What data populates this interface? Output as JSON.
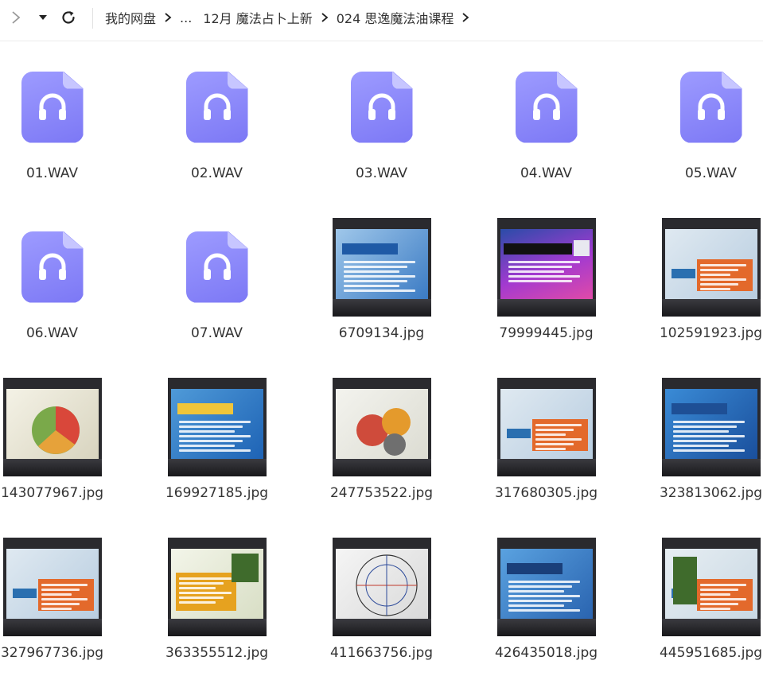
{
  "toolbar": {
    "back_icon": "chevron-right-icon",
    "dropdown_icon": "caret-down-icon",
    "refresh_icon": "refresh-icon"
  },
  "breadcrumb": {
    "items": [
      "我的网盘",
      "...",
      "12月 魔法占卜上新",
      "024 思逸魔法油课程"
    ]
  },
  "files": [
    {
      "name": "01.WAV",
      "type": "audio"
    },
    {
      "name": "02.WAV",
      "type": "audio"
    },
    {
      "name": "03.WAV",
      "type": "audio"
    },
    {
      "name": "04.WAV",
      "type": "audio"
    },
    {
      "name": "05.WAV",
      "type": "audio"
    },
    {
      "name": "06.WAV",
      "type": "audio"
    },
    {
      "name": "07.WAV",
      "type": "audio"
    },
    {
      "name": "6709134.jpg",
      "type": "image",
      "theme": "blue"
    },
    {
      "name": "79999445.jpg",
      "type": "image",
      "theme": "purple"
    },
    {
      "name": "102591923.jpg",
      "type": "image",
      "theme": "orange"
    },
    {
      "name": "143077967.jpg",
      "type": "image",
      "theme": "pie"
    },
    {
      "name": "169927185.jpg",
      "type": "image",
      "theme": "blue2"
    },
    {
      "name": "247753522.jpg",
      "type": "image",
      "theme": "gear"
    },
    {
      "name": "317680305.jpg",
      "type": "image",
      "theme": "orange"
    },
    {
      "name": "323813062.jpg",
      "type": "image",
      "theme": "blue3"
    },
    {
      "name": "327967736.jpg",
      "type": "image",
      "theme": "orange"
    },
    {
      "name": "363355512.jpg",
      "type": "image",
      "theme": "green"
    },
    {
      "name": "411663756.jpg",
      "type": "image",
      "theme": "chart"
    },
    {
      "name": "426435018.jpg",
      "type": "image",
      "theme": "blue4"
    },
    {
      "name": "445951685.jpg",
      "type": "image",
      "theme": "orange2"
    }
  ],
  "colors": {
    "audio_icon": "#8784fb",
    "slide_blue": "#2f7fd0",
    "slide_orange": "#e06a2c",
    "slide_purple": "#8a2fc7"
  }
}
